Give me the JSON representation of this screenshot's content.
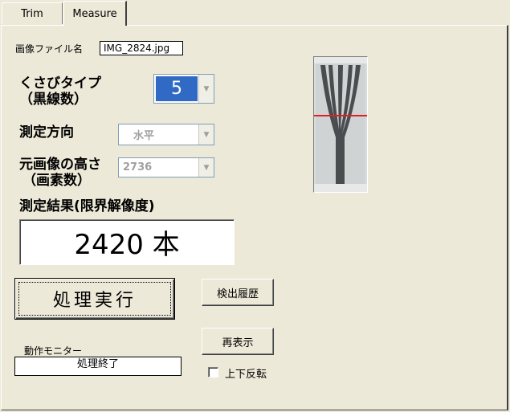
{
  "tabs": [
    {
      "label": "Trim"
    },
    {
      "label": "Measure"
    }
  ],
  "file": {
    "label": "画像ファイル名",
    "value": "IMG_2824.jpg"
  },
  "wedge_type": {
    "label_line1": "くさびタイプ",
    "label_line2": "（黒線数）",
    "value": "5"
  },
  "direction": {
    "label": "測定方向",
    "value": "水平"
  },
  "image_height": {
    "label_line1": "元画像の高さ",
    "label_line2": "（画素数）",
    "value": "2736"
  },
  "result": {
    "label": "測定結果(限界解像度)",
    "value": "2420 本"
  },
  "buttons": {
    "execute": "処理実行",
    "history": "検出履歴",
    "redisplay": "再表示"
  },
  "monitor": {
    "label": "動作モニター",
    "value": "処理終了"
  },
  "flip": {
    "label": "上下反転",
    "checked": false
  },
  "colors": {
    "selection": "#316ac5",
    "measure_line": "#e02020",
    "background": "#ece9d8"
  }
}
